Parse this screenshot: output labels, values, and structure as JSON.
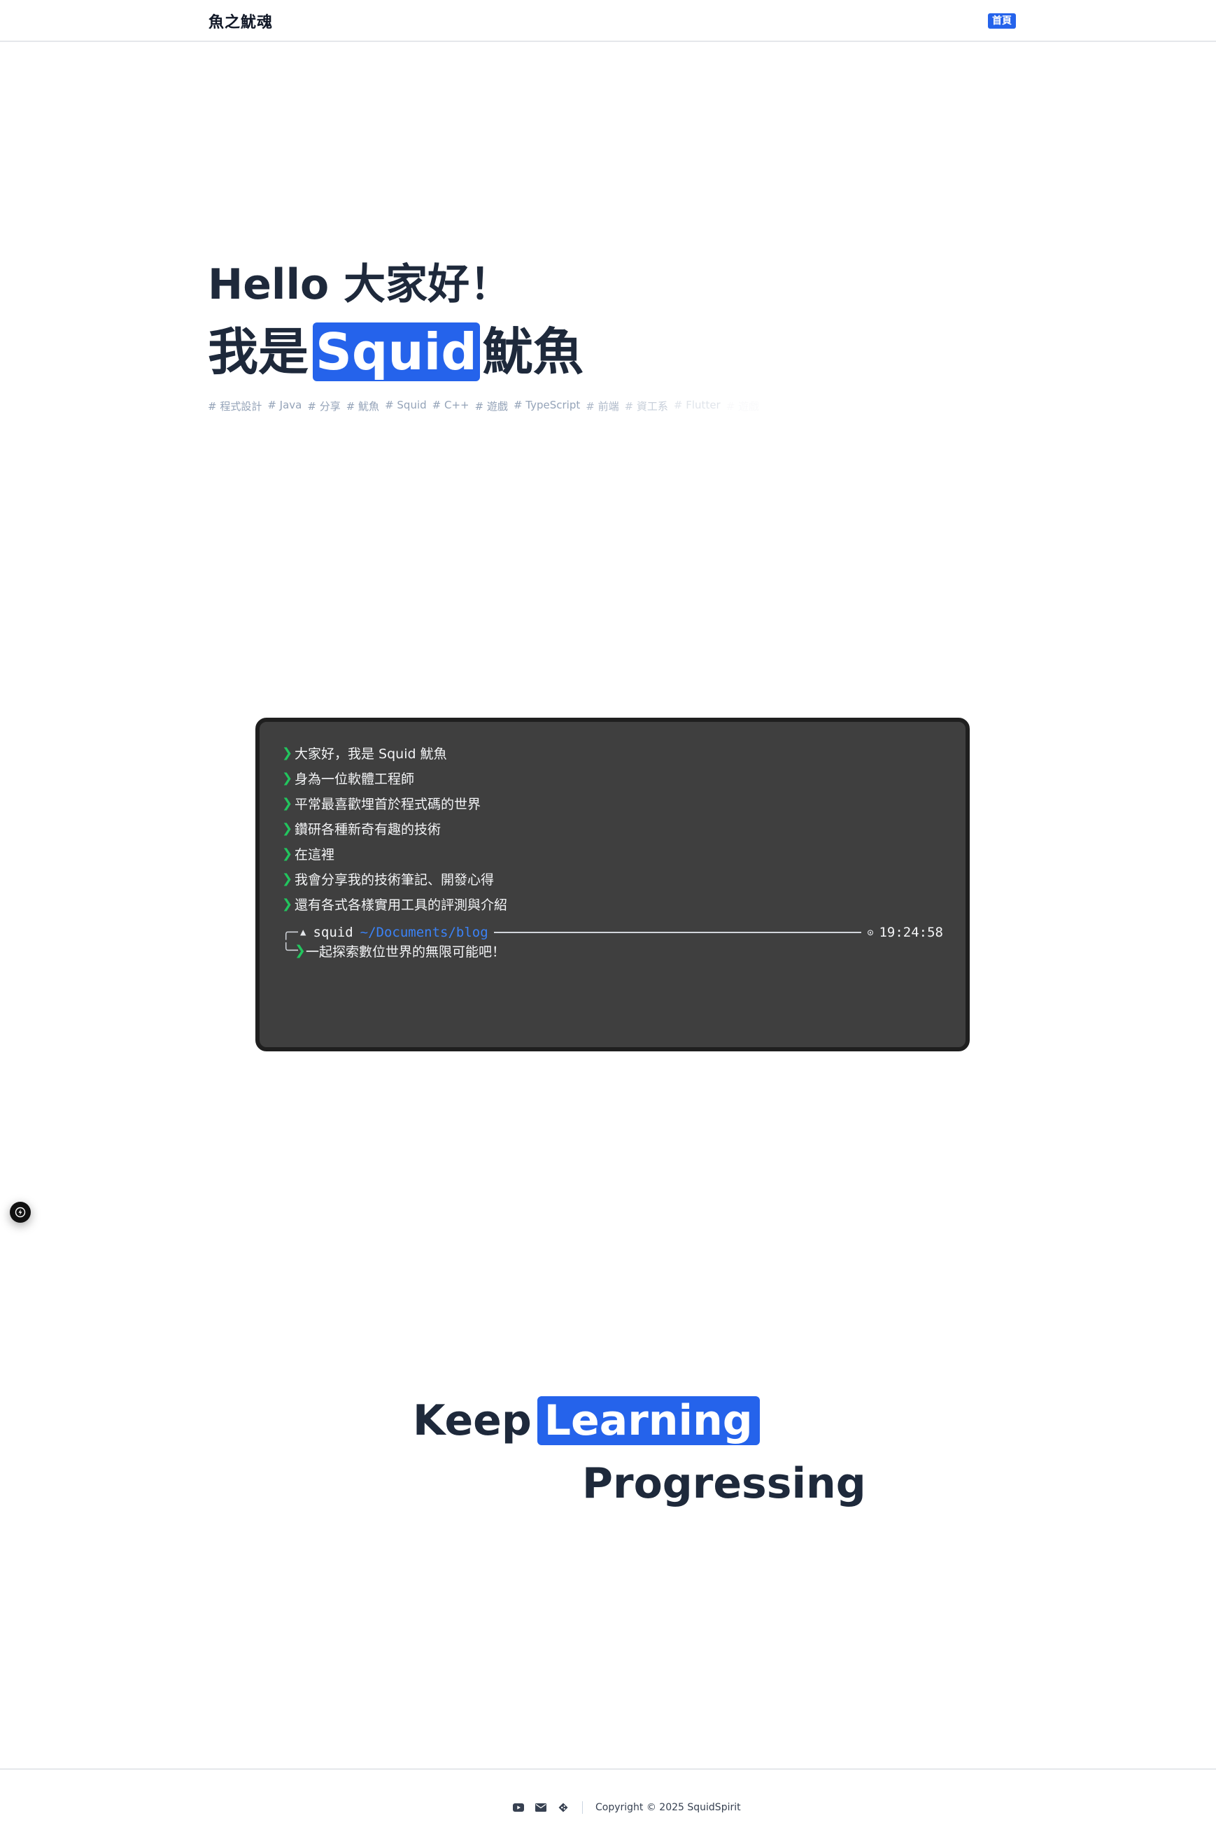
{
  "header": {
    "brand": "魚之魷魂",
    "nav_home": "首頁"
  },
  "hero": {
    "greeting": "Hello 大家好！",
    "name_prefix": "我是",
    "name_highlight": "Squid",
    "name_suffix": "魷魚",
    "tags": [
      "# 程式設計",
      "# Java",
      "# 分享",
      "# 魷魚",
      "# Squid",
      "# C++",
      "# 遊戲",
      "# TypeScript",
      "# 前端",
      "# 資工系",
      "# Flutter",
      "# 遊戲"
    ]
  },
  "terminal": {
    "lines": [
      "大家好，我是 Squid 魷魚",
      "身為一位軟體工程師",
      "平常最喜歡埋首於程式碼的世界",
      "鑽研各種新奇有趣的技術",
      "在這裡",
      "我會分享我的技術筆記、開發心得",
      "還有各式各樣實用工具的評測與介紹"
    ],
    "prompt_user": "squid",
    "prompt_path": "~/Documents/blog",
    "prompt_time": "19:24:58",
    "prompt_message": "一起探索數位世界的無限可能吧！"
  },
  "motto": {
    "keep": "Keep",
    "learning": "Learning",
    "progressing": "Progressing"
  },
  "footer": {
    "copyright": "Copyright © 2025 SquidSpirit",
    "icons": [
      "youtube-icon",
      "mail-icon",
      "gitea-icon"
    ]
  }
}
